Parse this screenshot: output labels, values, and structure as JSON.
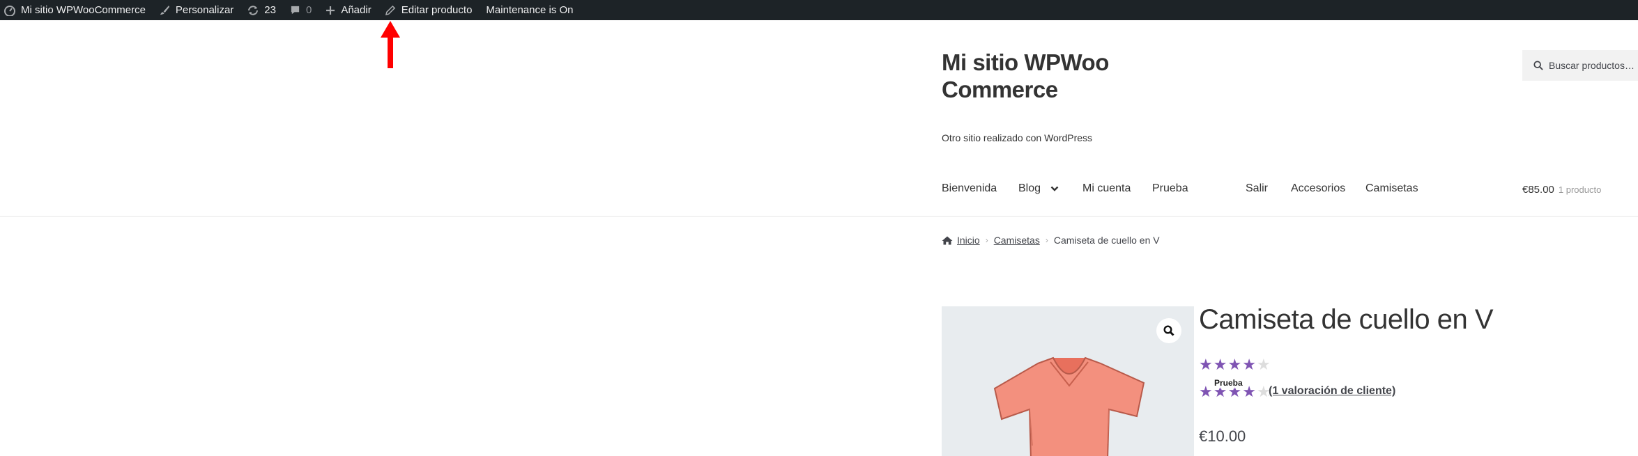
{
  "admin_bar": {
    "site_name": "Mi sitio WPWooCommerce",
    "customize": "Personalizar",
    "updates_count": "23",
    "comments_count": "0",
    "add_new": "Añadir",
    "edit_product": "Editar producto",
    "maintenance": "Maintenance is On",
    "icons": [
      "dashboard-icon",
      "brush-icon",
      "updates-icon",
      "comment-icon",
      "plus-icon",
      "pencil-icon"
    ],
    "background_color": "#1d2327"
  },
  "annotation": {
    "arrow_color": "#ff0000"
  },
  "header": {
    "site_title": "Mi sitio WPWooCommerce",
    "tagline": "Otro sitio realizado con WordPress",
    "search_placeholder": "Buscar productos…"
  },
  "nav": {
    "items": [
      "Bienvenida",
      "Blog",
      "Mi cuenta",
      "Prueba",
      "Salir",
      "Accesorios",
      "Camisetas"
    ]
  },
  "cart": {
    "total": "€85.00",
    "count": "1 producto"
  },
  "breadcrumb": {
    "home": "Inicio",
    "category": "Camisetas",
    "current": "Camiseta de cuello en V"
  },
  "product": {
    "title": "Camiseta de cuello en V",
    "rating": 4,
    "rating_max": 5,
    "rating_tooltip": "Prueba",
    "reviews_link": "(1 valoración de cliente)",
    "price": "€10.00",
    "accent_color": "#7f54b3",
    "shirt_color": "#f3907e"
  }
}
